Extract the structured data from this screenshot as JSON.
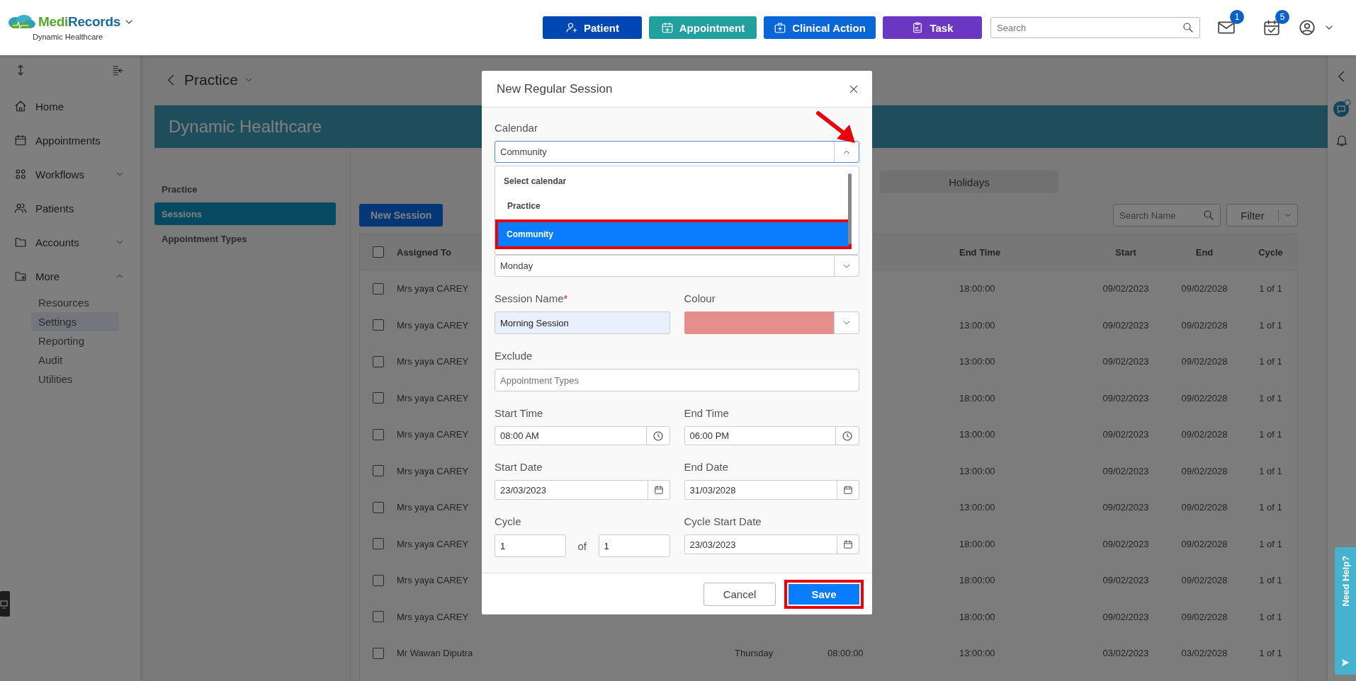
{
  "header": {
    "logo": {
      "first": "Medi",
      "second": "Records"
    },
    "org": "Dynamic Healthcare",
    "actions": [
      {
        "label": "Patient",
        "kind": "patient",
        "color": "#0047b3"
      },
      {
        "label": "Appointment",
        "kind": "appointment",
        "color": "#22a09e"
      },
      {
        "label": "Clinical Action",
        "kind": "clinical",
        "color": "#0a66d6"
      },
      {
        "label": "Task",
        "kind": "task",
        "color": "#6b36c2"
      }
    ],
    "search": {
      "placeholder": "Search"
    },
    "notifications": [
      {
        "kind": "mail",
        "count": "1"
      },
      {
        "kind": "tasks",
        "count": "5"
      }
    ]
  },
  "sidebar": {
    "items": [
      {
        "label": "Home",
        "kind": "home",
        "selected": false
      },
      {
        "label": "Appointments",
        "kind": "calendar",
        "selected": false
      },
      {
        "label": "Workflows",
        "kind": "workflows",
        "selected": false,
        "expanded": false
      },
      {
        "label": "Patients",
        "kind": "people",
        "selected": false
      },
      {
        "label": "Accounts",
        "kind": "folder",
        "selected": false,
        "expanded": false
      },
      {
        "label": "More",
        "kind": "folder-plus",
        "selected": false,
        "expanded": true,
        "children": [
          {
            "label": "Resources",
            "selected": false
          },
          {
            "label": "Settings",
            "selected": true
          },
          {
            "label": "Reporting",
            "selected": false
          },
          {
            "label": "Audit",
            "selected": false
          },
          {
            "label": "Utilities",
            "selected": false
          }
        ]
      }
    ]
  },
  "page": {
    "title": "Practice",
    "banner": "Dynamic Healthcare",
    "nav": [
      {
        "label": "Practice",
        "selected": false
      },
      {
        "label": "Sessions",
        "selected": true
      },
      {
        "label": "Appointment Types",
        "selected": false
      }
    ],
    "tabs": [
      {
        "label": "Holidays",
        "selected": false
      }
    ],
    "new_button": "New Session",
    "search": {
      "placeholder": "Search Name"
    },
    "filter": "Filter",
    "table": {
      "select_all": {
        "checked": false
      },
      "columns": {
        "assigned_to": "Assigned To",
        "end_time": "End Time",
        "start": "Start",
        "end": "End",
        "cycle": "Cycle"
      },
      "rows": [
        {
          "checked": false,
          "assigned_to": "Mrs yaya CAREY",
          "end_time": "18:00:00",
          "start": "09/02/2023",
          "end": "09/02/2028",
          "cycle": "1 of 1"
        },
        {
          "checked": false,
          "assigned_to": "Mrs yaya CAREY",
          "end_time": "13:00:00",
          "start": "09/02/2023",
          "end": "09/02/2028",
          "cycle": "1 of 1"
        },
        {
          "checked": false,
          "assigned_to": "Mrs yaya CAREY",
          "end_time": "13:00:00",
          "start": "09/02/2023",
          "end": "09/02/2028",
          "cycle": "1 of 1"
        },
        {
          "checked": false,
          "assigned_to": "Mrs yaya CAREY",
          "end_time": "18:00:00",
          "start": "09/02/2023",
          "end": "09/02/2028",
          "cycle": "1 of 1"
        },
        {
          "checked": false,
          "assigned_to": "Mrs yaya CAREY",
          "end_time": "13:00:00",
          "start": "09/02/2023",
          "end": "09/02/2028",
          "cycle": "1 of 1"
        },
        {
          "checked": false,
          "assigned_to": "Mrs yaya CAREY",
          "end_time": "13:00:00",
          "start": "09/02/2023",
          "end": "09/02/2028",
          "cycle": "1 of 1"
        },
        {
          "checked": false,
          "assigned_to": "Mrs yaya CAREY",
          "end_time": "13:00:00",
          "start": "09/02/2023",
          "end": "09/02/2028",
          "cycle": "1 of 1"
        },
        {
          "checked": false,
          "assigned_to": "Mrs yaya CAREY",
          "end_time": "18:00:00",
          "start": "09/02/2023",
          "end": "09/02/2028",
          "cycle": "1 of 1"
        },
        {
          "checked": false,
          "assigned_to": "Mrs yaya CAREY",
          "end_time": "18:00:00",
          "start": "09/02/2023",
          "end": "09/02/2028",
          "cycle": "1 of 1"
        },
        {
          "checked": false,
          "assigned_to": "Mrs yaya CAREY",
          "end_time": "18:00:00",
          "start": "09/02/2023",
          "end": "09/02/2028",
          "cycle": "1 of 1"
        },
        {
          "checked": false,
          "assigned_to": "Mr Wawan Diputra",
          "day": "Thursday",
          "start_time": "08:00:00",
          "end_time": "13:00:00",
          "start": "03/02/2023",
          "end": "03/02/2028",
          "cycle": "1 of 1"
        }
      ]
    }
  },
  "help": {
    "label": "Need Help?"
  },
  "modal": {
    "title": "New Regular Session",
    "calendar": {
      "label": "Calendar",
      "value": "Community",
      "expanded": true,
      "pointer_arrow": true,
      "options": [
        {
          "label": "Select calendar",
          "selected": false,
          "highlighted": false
        },
        {
          "label": "Practice",
          "selected": false,
          "highlighted": false
        },
        {
          "label": "Community",
          "selected": true,
          "highlighted": true
        }
      ]
    },
    "day": {
      "value": "Monday"
    },
    "session_name": {
      "label": "Session Name",
      "required": true,
      "required_mark": "*",
      "value": "Morning Session"
    },
    "colour": {
      "label": "Colour",
      "color": "#e58f8c"
    },
    "exclude": {
      "label": "Exclude",
      "placeholder": "Appointment Types"
    },
    "start_time": {
      "label": "Start Time",
      "value": "08:00 AM"
    },
    "end_time": {
      "label": "End Time",
      "value": "06:00 PM"
    },
    "start_date": {
      "label": "Start Date",
      "value": "23/03/2023"
    },
    "end_date": {
      "label": "End Date",
      "value": "31/03/2028"
    },
    "cycle": {
      "label": "Cycle",
      "value": "1",
      "of": "of",
      "total": "1"
    },
    "cycle_start_date": {
      "label": "Cycle Start Date",
      "value": "23/03/2023"
    },
    "cancel": "Cancel",
    "save": {
      "label": "Save",
      "highlighted": true
    }
  }
}
